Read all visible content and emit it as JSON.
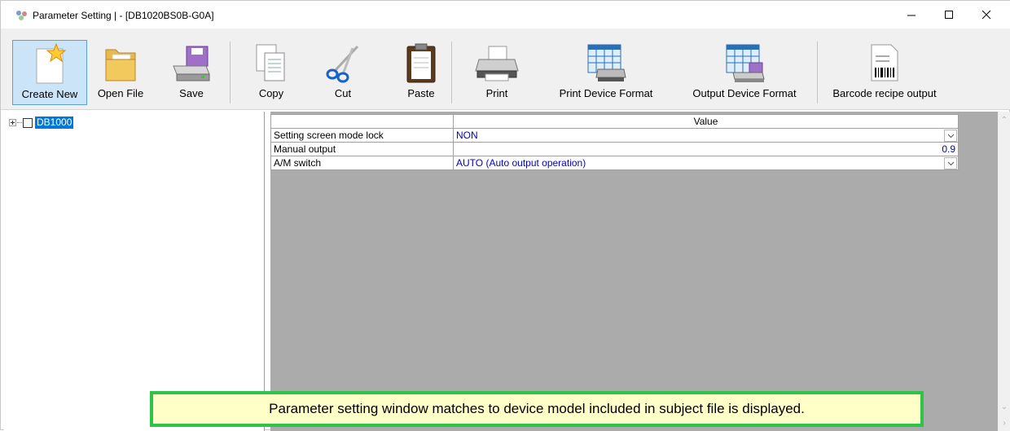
{
  "window": {
    "title": "Parameter Setting |  - [DB1020BS0B-G0A]"
  },
  "toolbar": {
    "buttons": [
      {
        "label": "Create New",
        "icon": "new-document-icon"
      },
      {
        "label": "Open File",
        "icon": "folder-icon"
      },
      {
        "label": "Save",
        "icon": "save-drive-icon"
      },
      {
        "label": "Copy",
        "icon": "copy-icon"
      },
      {
        "label": "Cut",
        "icon": "scissors-icon"
      },
      {
        "label": "Paste",
        "icon": "clipboard-icon"
      },
      {
        "label": "Print",
        "icon": "printer-icon"
      },
      {
        "label": "Print Device Format",
        "icon": "print-format-icon"
      },
      {
        "label": "Output Device Format",
        "icon": "output-format-icon"
      },
      {
        "label": "Barcode recipe output",
        "icon": "barcode-icon"
      }
    ]
  },
  "tree": {
    "root": {
      "label": "DB1000",
      "checked": false
    }
  },
  "grid": {
    "header": {
      "name": "",
      "value": "Value"
    },
    "rows": [
      {
        "name": "Setting screen mode lock",
        "value": "NON",
        "type": "dropdown"
      },
      {
        "name": "Manual output",
        "value": "0.9",
        "type": "number"
      },
      {
        "name": "A/M switch",
        "value": "AUTO (Auto output operation)",
        "type": "dropdown"
      }
    ]
  },
  "callout": {
    "text": "Parameter setting window matches to device model included in subject file is displayed."
  },
  "colors": {
    "selection": "#0078d7",
    "value_text": "#0000d0",
    "callout_border": "#2ec44a",
    "callout_bg": "#ffffc8"
  }
}
